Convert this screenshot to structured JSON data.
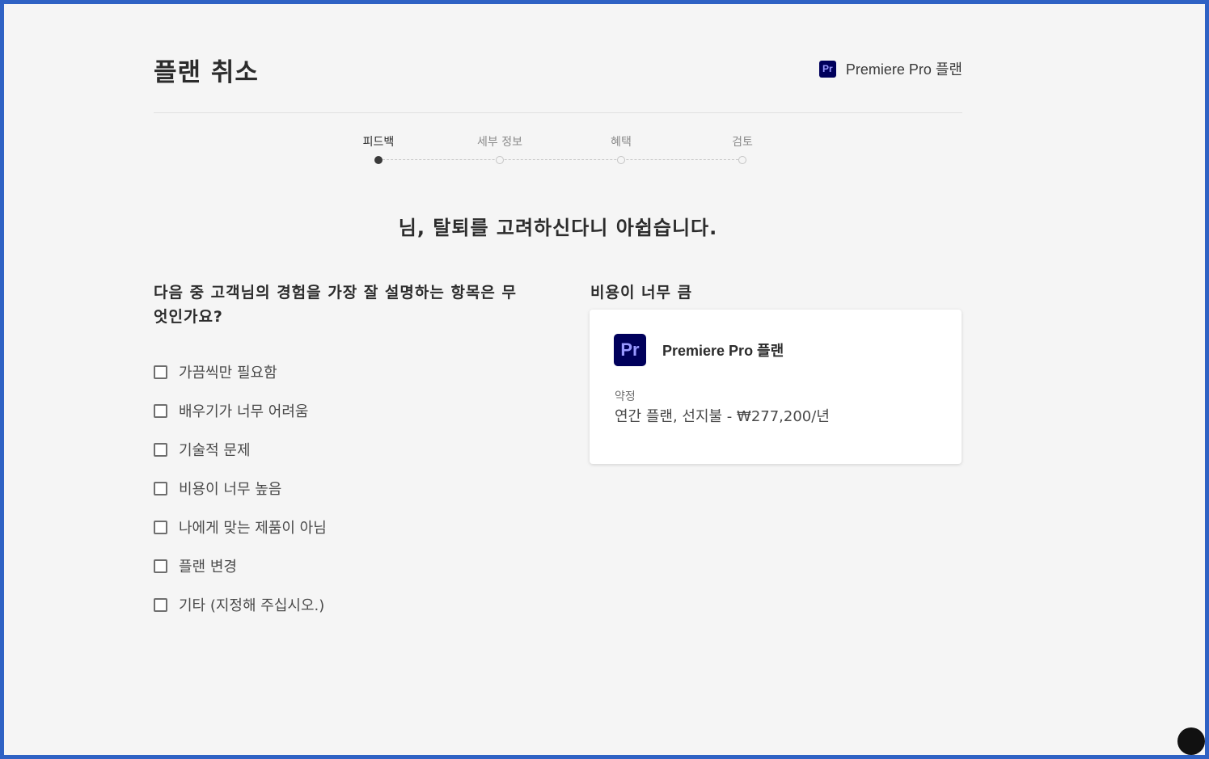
{
  "header": {
    "title": "플랜 취소",
    "plan_icon_text": "Pr",
    "plan_name": "Premiere Pro 플랜"
  },
  "steps": [
    {
      "label": "피드백",
      "active": true
    },
    {
      "label": "세부 정보",
      "active": false
    },
    {
      "label": "혜택",
      "active": false
    },
    {
      "label": "검토",
      "active": false
    }
  ],
  "heading": "님, 탈퇴를 고려하신다니 아쉽습니다.",
  "question": {
    "text": "다음 중 고객님의 경험을 가장 잘 설명하는 항목은 무엇인가요?",
    "options": [
      "가끔씩만 필요함",
      "배우기가 너무 어려움",
      "기술적 문제",
      "비용이 너무 높음",
      "나에게 맞는 제품이 아님",
      "플랜 변경",
      "기타 (지정해 주십시오.)"
    ]
  },
  "reason_title": "비용이 너무 큼",
  "card": {
    "icon_text": "Pr",
    "plan_name": "Premiere Pro 플랜",
    "term_label": "약정",
    "term_value": "연간 플랜, 선지불 - ₩277,200/년"
  },
  "colors": {
    "frame_border": "#2f62c4",
    "background": "#f5f5f5",
    "premiere_bg": "#00005b",
    "premiere_fg": "#9999ff"
  }
}
